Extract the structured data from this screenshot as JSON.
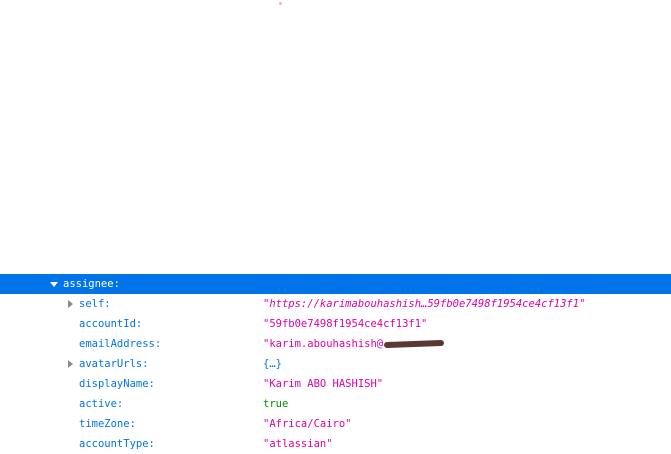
{
  "tree": {
    "header_key": "assignee:",
    "rows": [
      {
        "key": "self:",
        "value": "\"https://karimabouhashish…59fb0e7498f1954ce4cf13f1\"",
        "expandable": true
      },
      {
        "key": "accountId:",
        "value": "\"59fb0e7498f1954ce4cf13f1\""
      },
      {
        "key": "emailAddress:",
        "value": "\"karim.abouhashish@"
      },
      {
        "key": "avatarUrls:",
        "value": "{…}",
        "expandable": true
      },
      {
        "key": "displayName:",
        "value": "\"Karim ABO HASHISH\""
      },
      {
        "key": "active:",
        "value": "true"
      },
      {
        "key": "timeZone:",
        "value": "\"Africa/Cairo\""
      },
      {
        "key": "accountType:",
        "value": "\"atlassian\""
      }
    ]
  },
  "colors": {
    "selected_row": "#0074e8",
    "key": "#0074e8",
    "string": "#dd00a9",
    "boolean": "#058b00"
  }
}
